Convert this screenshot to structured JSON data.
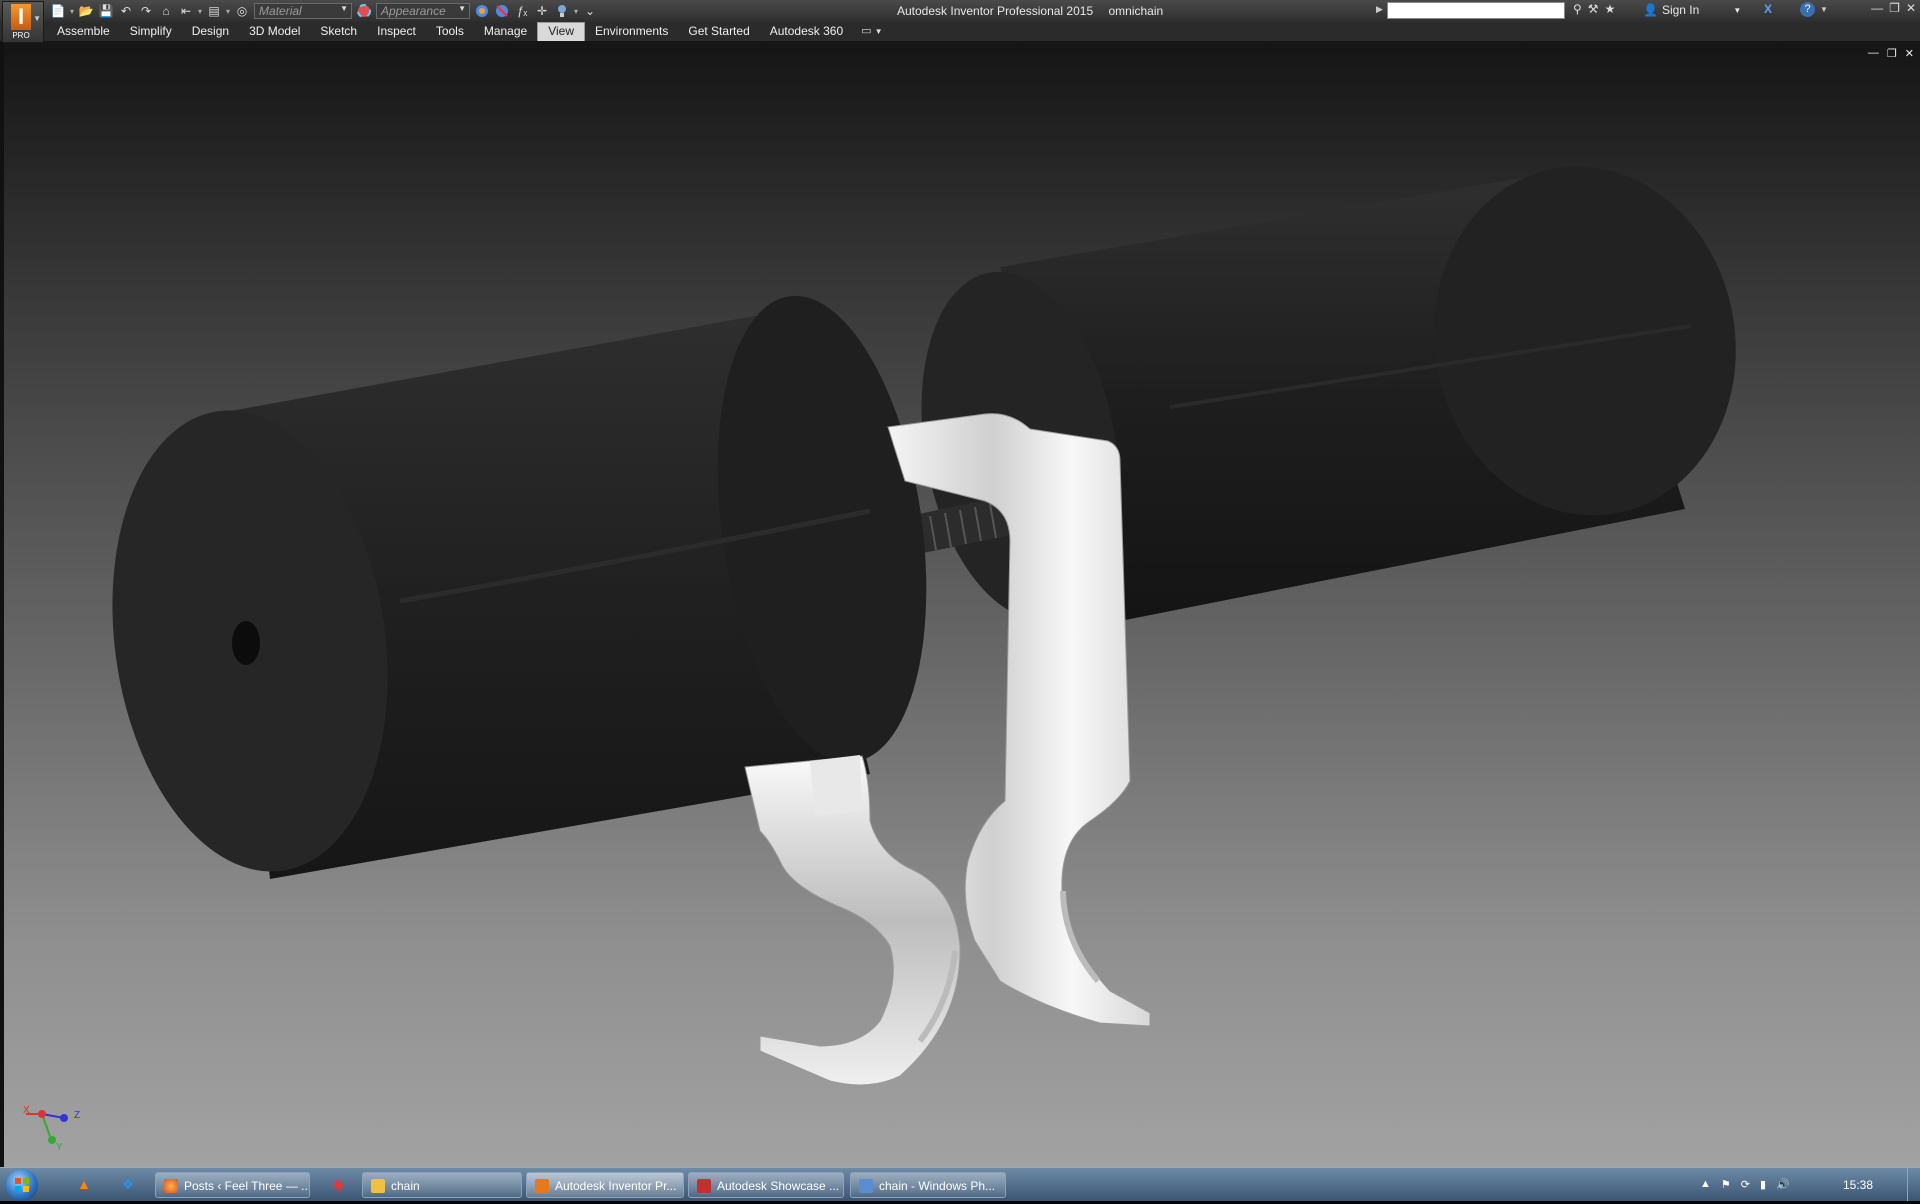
{
  "app": {
    "badge": "PRO",
    "window_title": "Autodesk Inventor Professional 2015",
    "document_name": "omnichain"
  },
  "quick_access": {
    "material_placeholder": "Material",
    "appearance_placeholder": "Appearance"
  },
  "header": {
    "sign_in_label": "Sign In",
    "search_value": ""
  },
  "ribbon": {
    "tabs": [
      {
        "label": "Assemble"
      },
      {
        "label": "Simplify"
      },
      {
        "label": "Design"
      },
      {
        "label": "3D Model"
      },
      {
        "label": "Sketch"
      },
      {
        "label": "Inspect"
      },
      {
        "label": "Tools"
      },
      {
        "label": "Manage"
      },
      {
        "label": "View",
        "active": true
      },
      {
        "label": "Environments"
      },
      {
        "label": "Get Started"
      },
      {
        "label": "Autodesk 360"
      }
    ]
  },
  "viewport": {
    "triad": {
      "x_label": "X",
      "y_label": "Y",
      "z_label": "Z"
    },
    "colors": {
      "roller": "#222222",
      "bracket": "#e6e6e6",
      "bolt": "#3a3a3a"
    }
  },
  "taskbar": {
    "buttons": [
      {
        "label": "Posts ‹ Feel Three — ...",
        "icon": "firefox-icon"
      },
      {
        "label": "chain",
        "icon": "folder-icon"
      },
      {
        "label": "Autodesk Inventor Pr...",
        "icon": "inventor-icon",
        "active": true
      },
      {
        "label": "Autodesk Showcase ...",
        "icon": "showcase-icon"
      },
      {
        "label": "chain - Windows Ph...",
        "icon": "photo-viewer-icon"
      }
    ],
    "clock": "15:38"
  }
}
